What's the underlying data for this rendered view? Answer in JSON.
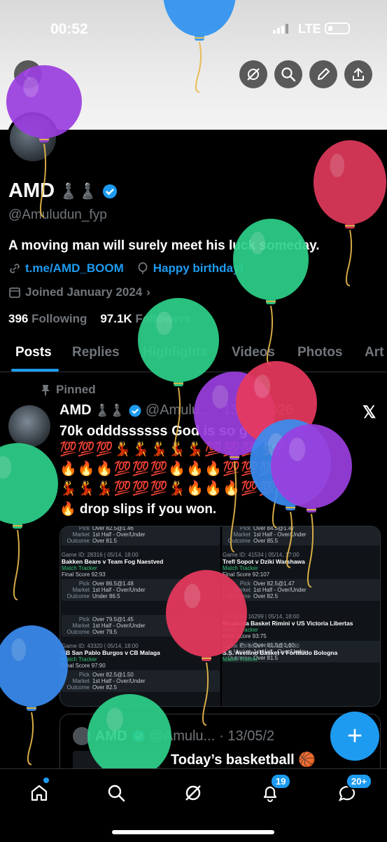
{
  "status": {
    "time": "00:52",
    "network": "LTE"
  },
  "profile": {
    "name": "AMD",
    "name_emojis": "♟️♟️",
    "handle": "@Amuludun_fyp",
    "bio": "A moving man will surely meet his luck someday.",
    "link": "t.me/AMD_BOOM",
    "birthday": "Happy birthday!",
    "joined": "Joined January 2024",
    "following_count": "396",
    "following_label": "Following",
    "followers_count": "97.1K",
    "followers_label": "Followers"
  },
  "tabs": [
    "Posts",
    "Replies",
    "Highlights",
    "Videos",
    "Photos",
    "Art"
  ],
  "pinned_post": {
    "pinned_label": "Pinned",
    "author": "AMD",
    "author_emojis": "♟️♟️",
    "handle": "@Amulu...",
    "date": "· 13/05/2026",
    "text": "70k odddssssss God is so good",
    "emoji_line1": "💯💯💯💃💃💃💃💃💯💯💯💃💃",
    "emoji_line2": "🔥🔥🔥💯💯💯🔥🔥🔥💯💯💯💯",
    "emoji_line3": "💃💃💃💯💯💯💃🔥🔥🔥💯💯🔥",
    "text2": "🔥 drop slips if you won.",
    "slips_left": [
      {
        "game": "",
        "teams": "",
        "final": "",
        "pick": "Over 82.5@1.46",
        "market": "1st Half - Over/Under",
        "outcome": "Over 81.5"
      },
      {
        "game": "Game ID: 28316 | 05/14, 18:00",
        "teams": "Bakken Bears v Team Fog Naestved",
        "final": "Final Score  92:93",
        "pick": "Over 86.5@1.48",
        "market": "1st Half - Over/Under",
        "outcome": "Under 86.5"
      },
      {
        "game": "",
        "teams": "",
        "final": "",
        "pick": "Over 79.5@1.45",
        "market": "1st Half - Over/Under",
        "outcome": "Over 79.5"
      },
      {
        "game": "Game ID: 43320 | 05/14, 18:00",
        "teams": "CB San Pablo Burgos v CB Malaga",
        "final": "Final Score  97:90",
        "pick": "Over 82.5@1.50",
        "market": "1st Half - Over/Under",
        "outcome": "Over 82.5"
      }
    ],
    "slips_right": [
      {
        "game": "",
        "teams": "",
        "final": "",
        "pick": "Over 84.5@1.47",
        "market": "1st Half - Over/Under",
        "outcome": "Over 85.5"
      },
      {
        "game": "Game ID: 41534 | 05/14, 17:00",
        "teams": "Trefl Sopot v Dziki Warshawa",
        "final": "Final Score  92:107",
        "pick": "Over 82.5@1.47",
        "market": "1st Half - Over/Under",
        "outcome": "Over 82.5"
      },
      {
        "game": "Game ID: 16299 | 05/14, 18:00",
        "teams": "Rinascita Basket Rimini v US Victoria Libertas",
        "final": "Final Score  93:75",
        "pick": "Over 81.5@1.60",
        "market": "1st Half - Over/Under",
        "outcome": "Over 81.5"
      },
      {
        "game": "Game ID: 36107 | 05/14, 19:30",
        "teams": "S.S. Avellino Basket v Fortitudo Bologna",
        "final": "",
        "pick": "",
        "market": "",
        "outcome": ""
      }
    ],
    "match_tracker": "Match Tracker",
    "pick_label": "Pick",
    "market_label": "Market",
    "outcome_label": "Outcome"
  },
  "quote_post": {
    "author": "AMD",
    "handle": "@Amulu...",
    "date": "· 13/05/2",
    "text": "Today’s basketball 🏀"
  },
  "bottom_nav": {
    "notifications_badge": "19",
    "messages_badge": "20+"
  },
  "colors": {
    "accent": "#1d9bf0",
    "background": "#000000",
    "muted": "#71767b"
  },
  "icons": [
    "back-arrow-icon",
    "grok-icon",
    "search-icon",
    "edit-icon",
    "share-icon",
    "verified-icon",
    "link-icon",
    "balloon-icon",
    "calendar-icon",
    "pin-icon",
    "x-logo-icon",
    "plus-icon",
    "home-icon",
    "notifications-icon",
    "messages-icon"
  ]
}
